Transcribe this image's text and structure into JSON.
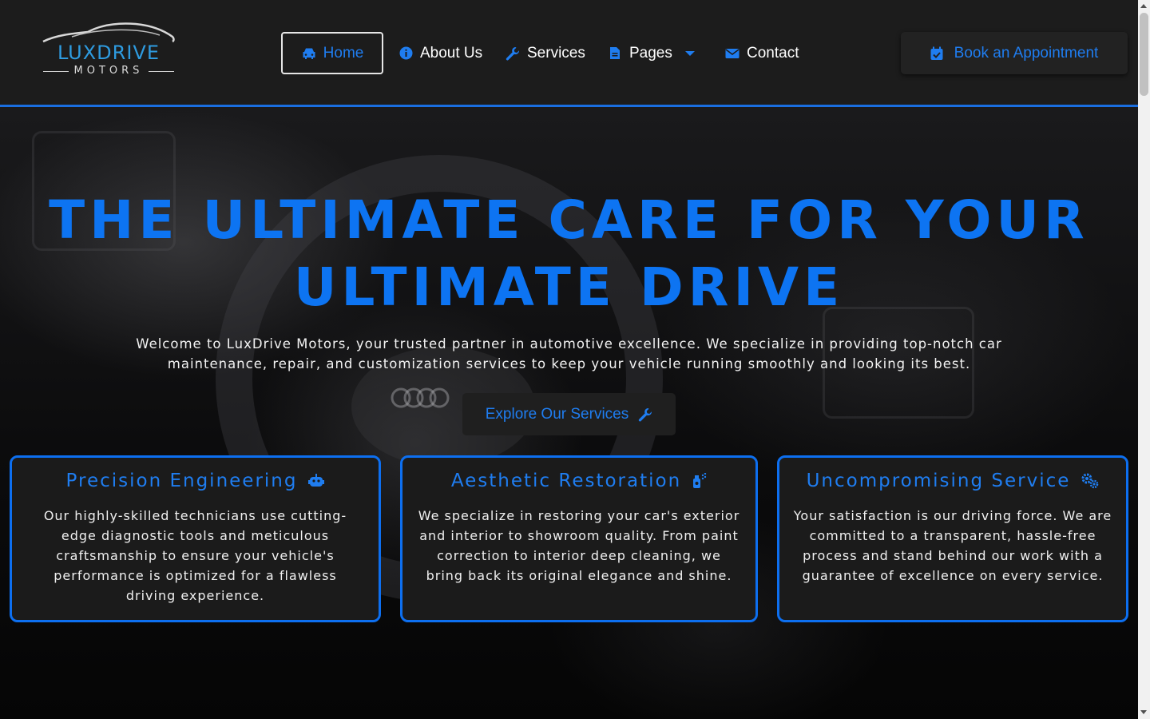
{
  "brand": {
    "name": "LUXDRIVE",
    "sub": "MOTORS"
  },
  "nav": {
    "items": [
      {
        "label": "Home",
        "icon": "car-icon"
      },
      {
        "label": "About Us",
        "icon": "info-circle-icon"
      },
      {
        "label": "Services",
        "icon": "wrench-icon"
      },
      {
        "label": "Pages",
        "icon": "document-icon"
      },
      {
        "label": "Contact",
        "icon": "envelope-icon"
      }
    ],
    "cta": "Book an Appointment"
  },
  "hero": {
    "title_line1": "THE ULTIMATE CARE FOR YOUR",
    "title_line2": "ULTIMATE DRIVE",
    "text": "Welcome to LuxDrive Motors, your trusted partner in automotive excellence. We specialize in providing top-notch car maintenance, repair, and customization services to keep your vehicle running smoothly and looking its best.",
    "button": "Explore Our Services"
  },
  "cards": [
    {
      "title": "Precision Engineering",
      "icon": "robot-icon",
      "text": "Our highly-skilled technicians use cutting-edge diagnostic tools and meticulous craftsmanship to ensure your vehicle's performance is optimized for a flawless driving experience."
    },
    {
      "title": "Aesthetic Restoration",
      "icon": "spray-can-icon",
      "text": "We specialize in restoring your car's exterior and interior to showroom quality. From paint correction to interior deep cleaning, we bring back its original elegance and shine."
    },
    {
      "title": "Uncompromising Service",
      "icon": "gears-icon",
      "text": "Your satisfaction is our driving force. We are committed to a transparent, hassle-free process and stand behind our work with a guarantee of excellence on every service."
    }
  ],
  "colors": {
    "accent": "#0d74f2",
    "header_bg": "#1c1c1c",
    "card_bg": "#1b1b1b"
  }
}
